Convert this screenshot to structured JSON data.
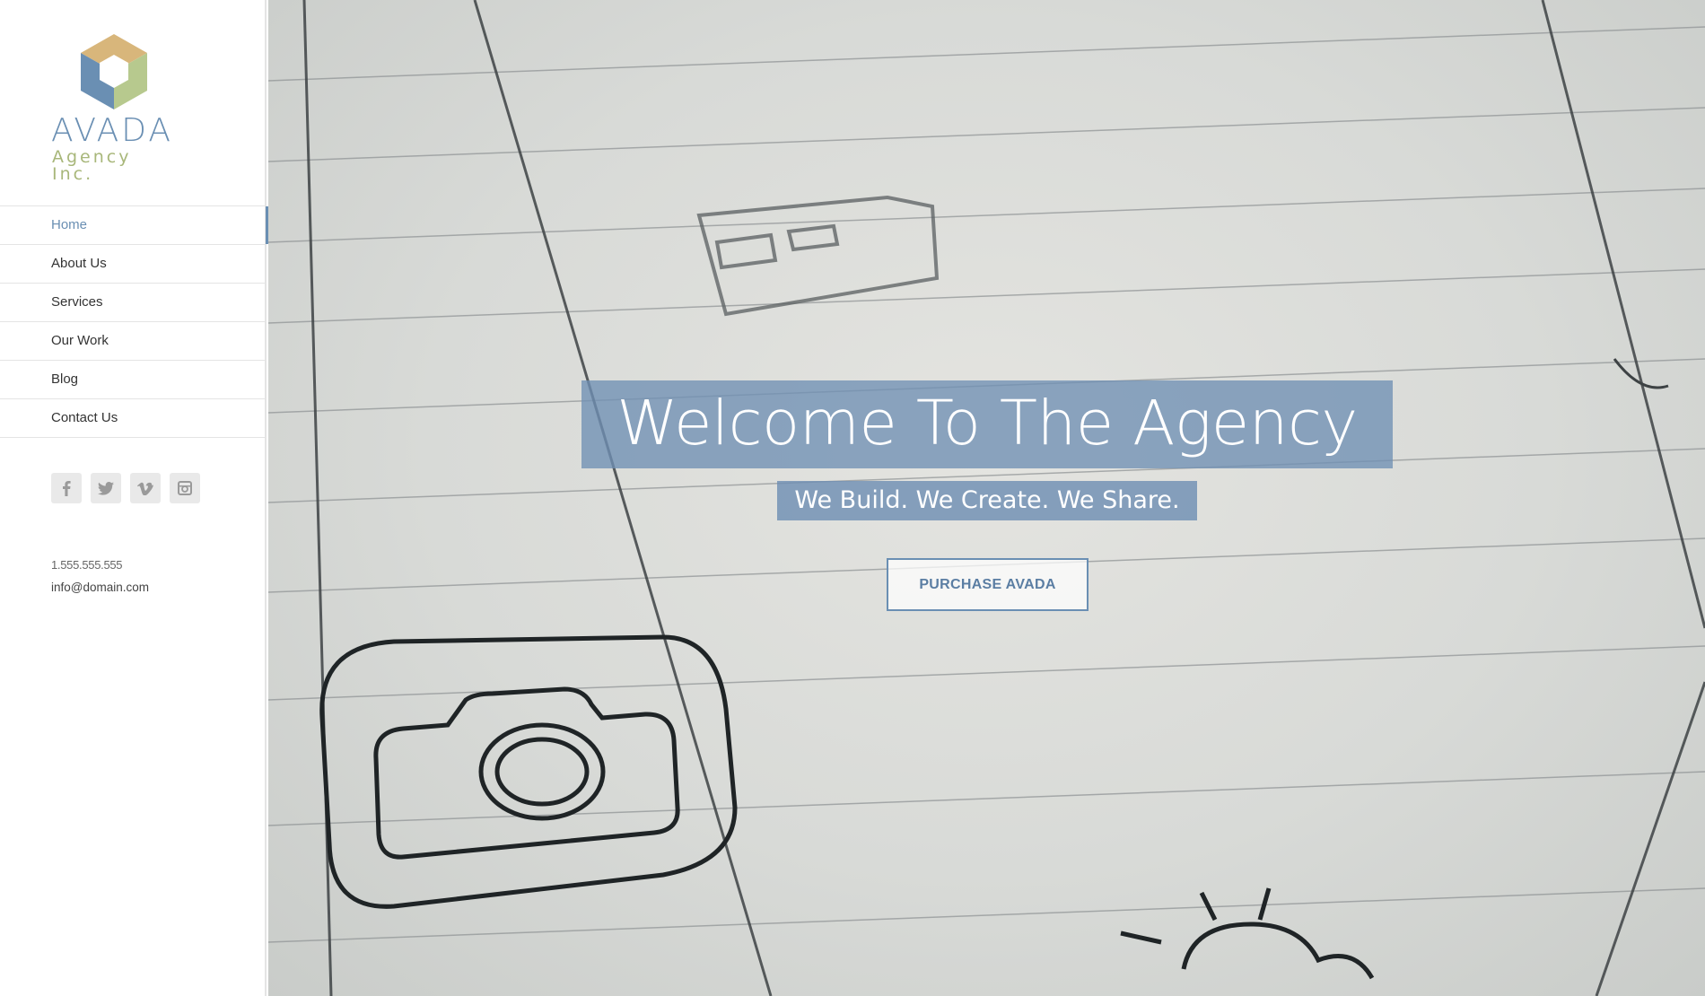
{
  "brand": {
    "name": "AVADA",
    "tagline": "Agency Inc.",
    "colors": {
      "blue": "#6a8fb3",
      "tan": "#d8b67b",
      "green": "#b7c98e"
    }
  },
  "nav": {
    "items": [
      {
        "label": "Home",
        "active": true
      },
      {
        "label": "About Us"
      },
      {
        "label": "Services"
      },
      {
        "label": "Our Work"
      },
      {
        "label": "Blog"
      },
      {
        "label": "Contact Us"
      }
    ]
  },
  "social": {
    "icons": [
      "facebook-icon",
      "twitter-icon",
      "vimeo-icon",
      "instagram-icon"
    ],
    "glyphs": [
      "f",
      "🐦",
      "v",
      "▣"
    ]
  },
  "contact": {
    "phone": "1.555.555.555",
    "email": "info@domain.com"
  },
  "hero": {
    "title": "Welcome To The Agency",
    "subtitle": "We Build. We Create. We Share.",
    "button_label": "PURCHASE AVADA"
  }
}
